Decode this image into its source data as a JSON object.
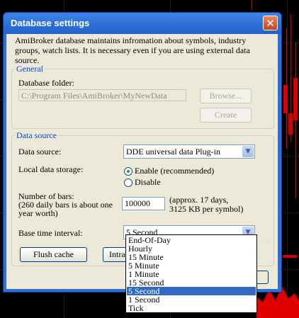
{
  "window": {
    "title": "Database settings",
    "close_glyph": "✕",
    "intro": "AmiBroker database maintains infromation about symbols, industry groups, watch lists. It is necessary even if you are using external data source."
  },
  "general": {
    "legend": "General",
    "folder_label": "Database folder:",
    "folder_value": "C:\\Program Files\\AmiBroker\\MyNewData",
    "browse_label": "Browse...",
    "create_label": "Create"
  },
  "datasource": {
    "legend": "Data source",
    "source_label": "Data source:",
    "source_value": "DDE universal data Plug-in",
    "local_label": "Local data storage:",
    "enable_label": "Enable (recommended)",
    "disable_label": "Disable",
    "local_selected": "Enable",
    "bars_label_1": "Number of bars:",
    "bars_label_2": "(260 daily bars is about one",
    "bars_label_3": "year worth)",
    "bars_value": "100000",
    "bars_note_1": "(approx. 17 days,",
    "bars_note_2": "3125 KB per symbol)",
    "interval_label": "Base time interval:",
    "interval_value": "5 Second",
    "interval_options": [
      "End-Of-Day",
      "Hourly",
      "15 Minute",
      "5 Minute",
      "1 Minute",
      "15 Second",
      "5 Second",
      "1 Second",
      "Tick"
    ],
    "interval_highlighted": "5 Second",
    "flush_label": "Flush cache",
    "intraday_label": "Intra"
  },
  "icons": {
    "dropdown_arrow": "▼",
    "star": "☆"
  },
  "colors": {
    "title_bar": "#2461c8",
    "dialog_bg": "#ece9d8",
    "legend_text": "#0046d5",
    "selection": "#316ac5",
    "chart_bg": "#000000",
    "candle": "#d40000"
  }
}
